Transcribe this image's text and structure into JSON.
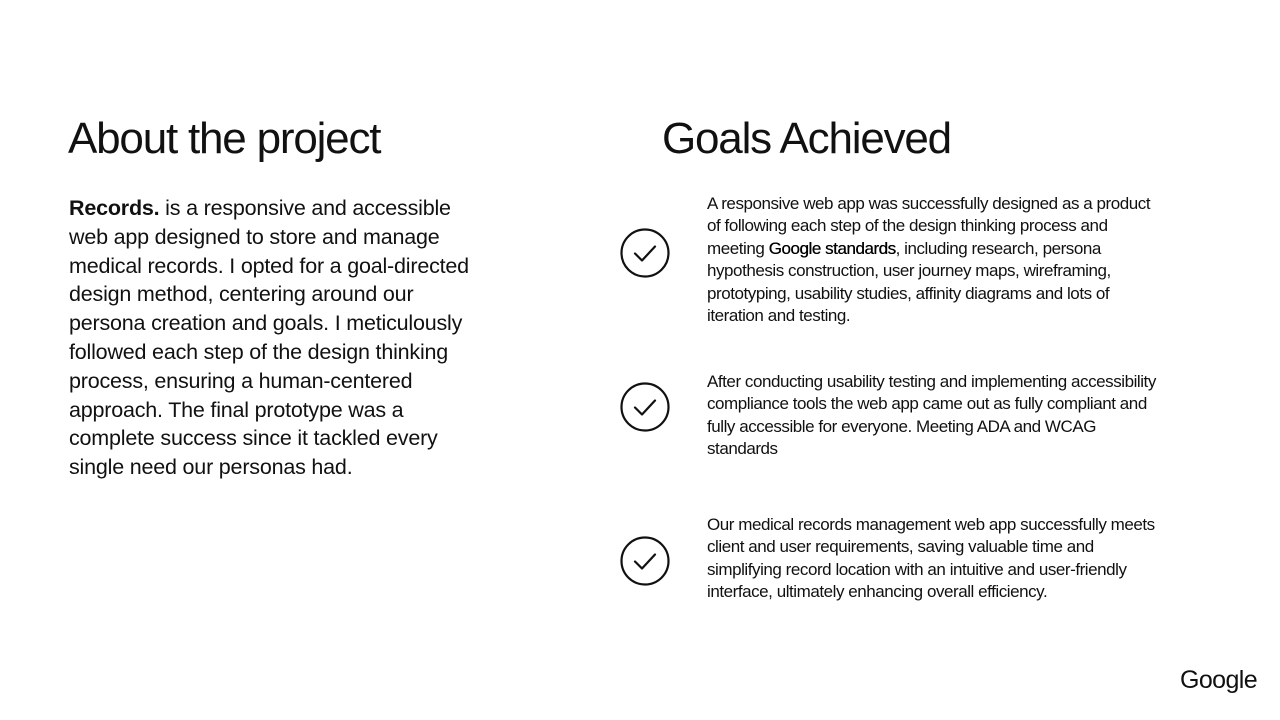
{
  "about": {
    "title": "About the project",
    "brand_name": "Records.",
    "body": " is a responsive and accessible web app designed to store and manage medical records. I opted for a goal-directed design method, centering around our persona creation and goals. I meticulously followed each step of the design thinking process, ensuring a human-centered approach. The final prototype was a complete success since it tackled every single need our personas had."
  },
  "goals": {
    "title": "Goals Achieved",
    "icon": "check-circle-icon",
    "items": [
      {
        "before": "A responsive web app was successfully designed as a product of following each step of the design thinking process and meeting ",
        "emphasis": "Google standards",
        "after": ", including research, persona hypothesis construction, user journey maps, wireframing, prototyping, usability studies, affinity diagrams and lots of iteration and testing."
      },
      {
        "text": "After conducting usability testing and implementing accessibility compliance tools the web app came out as fully compliant and fully accessible for everyone. Meeting ADA and WCAG standards"
      },
      {
        "text": "Our medical records management web app successfully meets client and user requirements, saving valuable time and simplifying record location with an intuitive and user-friendly interface, ultimately enhancing overall efficiency."
      }
    ]
  },
  "footer": {
    "logo_text": "Google"
  }
}
